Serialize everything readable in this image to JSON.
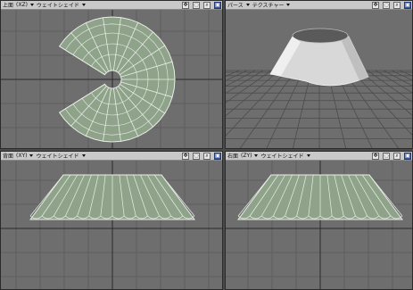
{
  "viewports": {
    "top": {
      "view_label": "上面",
      "axis_label": "(XZ)",
      "shading_label": "ウェイトシェイド"
    },
    "persp": {
      "view_label": "パース",
      "shading_label": "テクスチャー"
    },
    "back": {
      "view_label": "背面",
      "axis_label": "(XY)",
      "shading_label": "ウェイトシェイド"
    },
    "right": {
      "view_label": "右面",
      "axis_label": "(ZY)",
      "shading_label": "ウェイトシェイド"
    }
  },
  "icons": [
    "move-view-icon",
    "rotate-view-icon",
    "zoom-icon",
    "maximize-icon",
    "axis-arrow-icon"
  ],
  "colors": {
    "mesh_fill": "#8fa38a",
    "mesh_edge": "#e8eee6",
    "grid": "#5e5e5e",
    "axis": "#2a2a2a",
    "toolbar": "#c9c9c9"
  }
}
